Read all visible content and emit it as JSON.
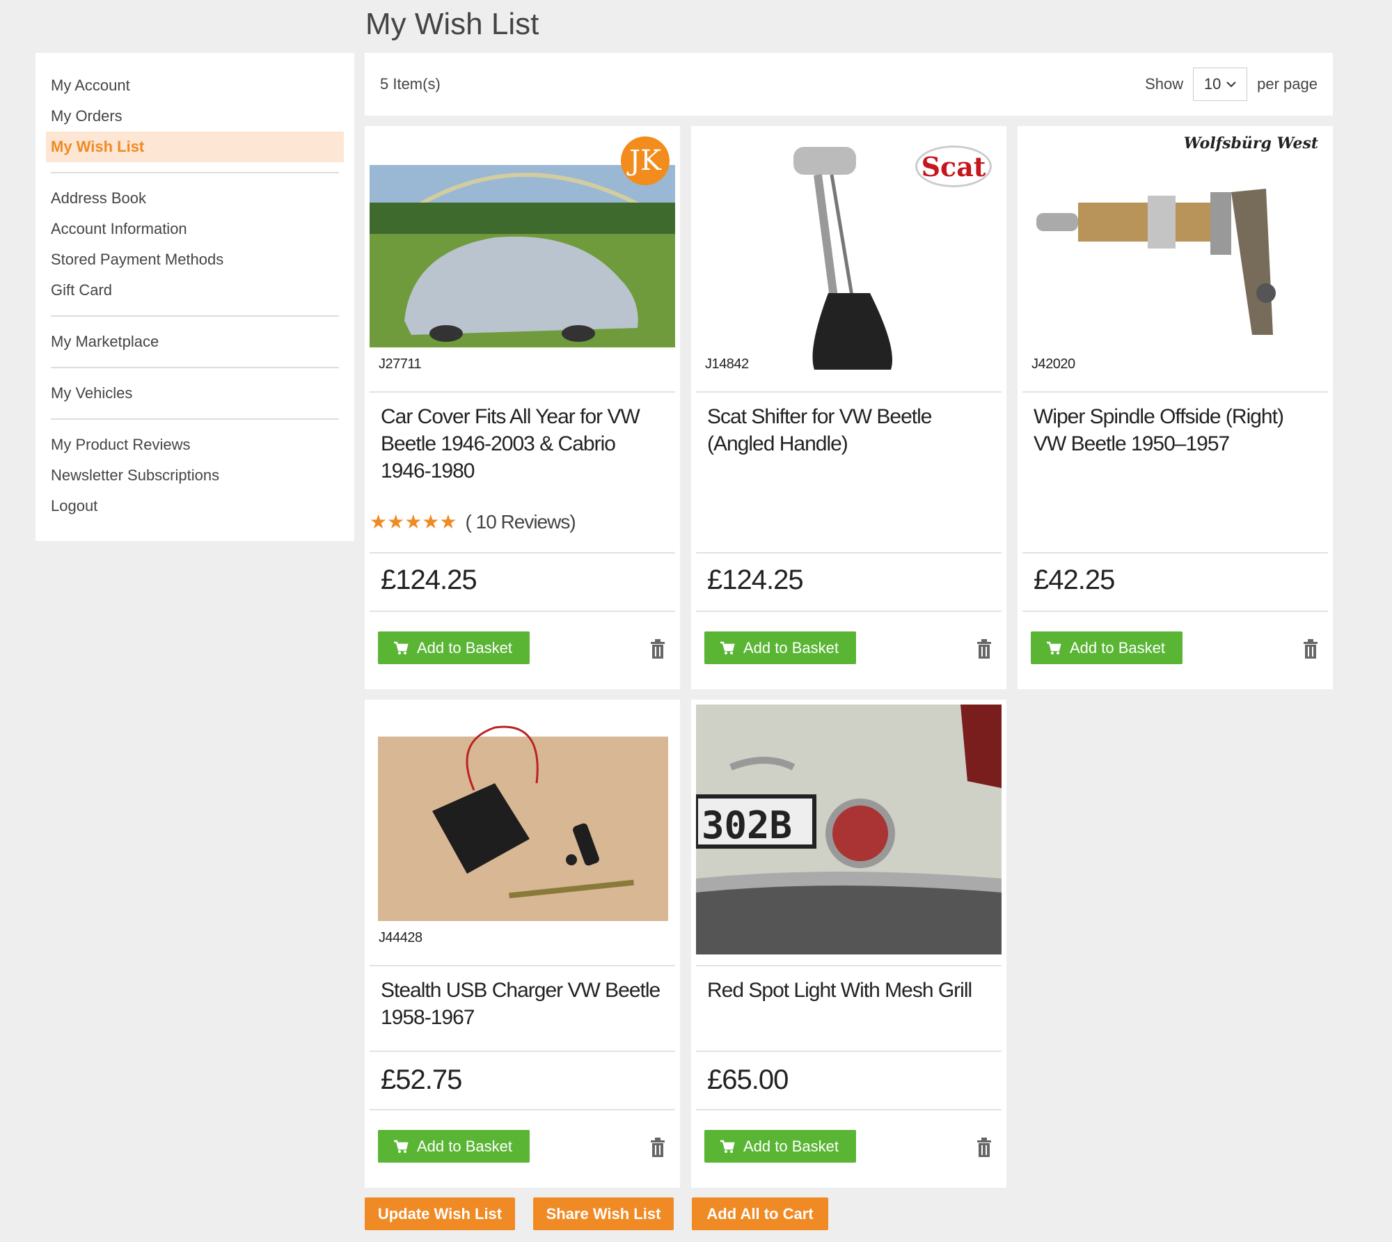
{
  "page": {
    "title": "My Wish List"
  },
  "sidebar": {
    "groups": [
      [
        "My Account",
        "My Orders",
        "My Wish List"
      ],
      [
        "Address Book",
        "Account Information",
        "Stored Payment Methods",
        "Gift Card"
      ],
      [
        "My Marketplace"
      ],
      [
        "My Vehicles"
      ],
      [
        "My Product Reviews",
        "Newsletter Subscriptions",
        "Logout"
      ]
    ],
    "active": "My Wish List"
  },
  "toolbar": {
    "count": "5 Item(s)",
    "show_label": "Show",
    "per_page_value": "10",
    "per_page_label": "per page"
  },
  "products": [
    {
      "sku": "J27711",
      "name": "Car Cover Fits All Year for VW Beetle 1946-2003 & Cabrio 1946-1980",
      "rating_stars": 5,
      "reviews": "( 10 Reviews)",
      "price": "£124.25",
      "brand_logo": "JK"
    },
    {
      "sku": "J14842",
      "name": "Scat Shifter for VW Beetle (Angled Handle)",
      "price": "£124.25",
      "brand_logo": "Scat"
    },
    {
      "sku": "J42020",
      "name": "Wiper Spindle Offside (Right) VW Beetle 1950–1957",
      "price": "£42.25",
      "brand_logo": "Wolfsbürg West"
    },
    {
      "sku": "J44428",
      "name": "Stealth USB Charger VW Beetle 1958-1967",
      "price": "£52.75"
    },
    {
      "sku": "",
      "name": "Red Spot Light With Mesh Grill",
      "price": "£65.00",
      "plate_text": "302B"
    }
  ],
  "add_to_basket_label": "Add to Basket",
  "actions": {
    "update": "Update Wish List",
    "share": "Share Wish List",
    "add_all": "Add All to Cart"
  },
  "colors": {
    "accent": "#f08a24",
    "green": "#5ab535",
    "active_bg": "#fde6d3"
  },
  "icons": {
    "cart": "cart-icon",
    "trash": "trash-icon",
    "star": "star-icon",
    "chevron": "chevron-down-icon"
  }
}
